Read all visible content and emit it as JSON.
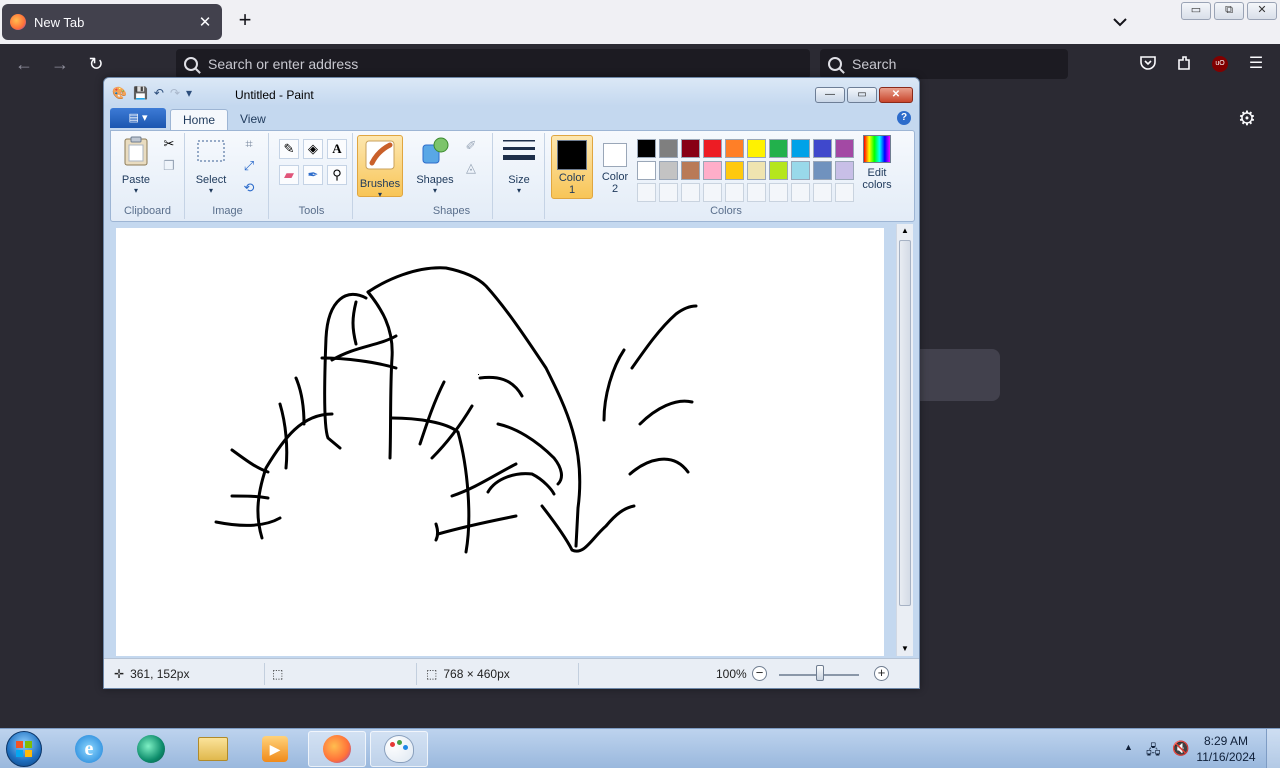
{
  "browser": {
    "tab_title": "New Tab",
    "tab_close": "✕",
    "new_tab": "+",
    "url_placeholder": "Search or enter address",
    "search_placeholder": "Search",
    "window_controls": [
      "▭",
      "⧉",
      "✕"
    ]
  },
  "paint": {
    "title": "Untitled - Paint",
    "tabs": [
      "Home",
      "View"
    ],
    "groups": {
      "clipboard": "Clipboard",
      "image": "Image",
      "tools": "Tools",
      "shapes": "Shapes",
      "colors": "Colors"
    },
    "buttons": {
      "paste": "Paste",
      "select": "Select",
      "brushes": "Brushes",
      "shapes": "Shapes",
      "size": "Size",
      "color1_line1": "Color",
      "color1_line2": "1",
      "color2_line1": "Color",
      "color2_line2": "2",
      "edit_colors_line1": "Edit",
      "edit_colors_line2": "colors"
    },
    "palette_row1": [
      "#000000",
      "#7f7f7f",
      "#880015",
      "#ed1c24",
      "#ff7f27",
      "#fff200",
      "#22b14c",
      "#00a2e8",
      "#3f48cc",
      "#a349a4"
    ],
    "palette_row2": [
      "#ffffff",
      "#c3c3c3",
      "#b97a57",
      "#ffaec9",
      "#ffc90e",
      "#efe4b0",
      "#b5e61d",
      "#99d9ea",
      "#7092be",
      "#c8bfe7"
    ],
    "color1": "#000000",
    "color2": "#ffffff",
    "status": {
      "cursor_pos": "361, 152px",
      "canvas_size": "768 × 460px",
      "zoom": "100%"
    }
  },
  "taskbar": {
    "time": "8:29 AM",
    "date": "11/16/2024"
  },
  "icons": [
    "firefox-icon",
    "paint-icon",
    "search-icon",
    "gear-icon",
    "pocket-icon",
    "extensions-icon",
    "menu-icon"
  ]
}
